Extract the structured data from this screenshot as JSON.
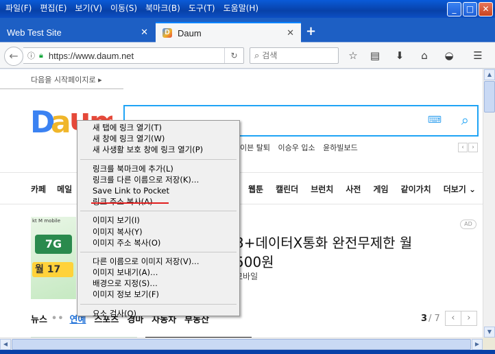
{
  "menubar": {
    "items": [
      "파일(F)",
      "편집(E)",
      "보기(V)",
      "이동(S)",
      "북마크(B)",
      "도구(T)",
      "도움말(H)"
    ]
  },
  "tabs": [
    {
      "title": "Web Test Site",
      "active": false
    },
    {
      "title": "Daum",
      "active": true
    }
  ],
  "navbar": {
    "url": "https://www.daum.net",
    "search_placeholder": "검색"
  },
  "page": {
    "start_page_link": "다음을 시작페이지로",
    "keywords": [
      "이븐 탈퇴",
      "이승우 입소",
      "윤하빌보드"
    ],
    "gnb_left": [
      "카페",
      "메일"
    ],
    "gnb_right": [
      "웹툰",
      "캘린더",
      "브런치",
      "사전",
      "게임",
      "같이가치",
      "더보기"
    ],
    "ad": {
      "brand": "kt M mobile",
      "img_big": "7G",
      "img_yellow": "월 17",
      "headline1": "3+데이터X통화 완전무제한 월",
      "headline2": "500원",
      "sub": "모바일",
      "badge": "AD"
    },
    "news": {
      "label": "뉴스",
      "tabs": [
        "연예",
        "스포츠",
        "경마",
        "자동차",
        "부동산"
      ],
      "active_tab": "연예",
      "page_current": "3",
      "page_total": "/ 7"
    }
  },
  "context_menu": {
    "group1": [
      "새 탭에 링크 열기(T)",
      "새 창에 링크 열기(W)",
      "새 사생활 보호 창에 링크 열기(P)"
    ],
    "group2": [
      "링크를 북마크에 추가(L)",
      "링크를 다른 이름으로 저장(K)…",
      "Save Link to Pocket",
      "링크 주소 복사(A)"
    ],
    "group3": [
      "이미지 보기(I)",
      "이미지 복사(Y)",
      "이미지 주소 복사(O)"
    ],
    "group4": [
      "다른 이름으로 이미지 저장(V)…",
      "이미지 보내기(A)…",
      "배경으로 지정(S)…",
      "이미지 정보 보기(F)"
    ],
    "group5": [
      "요소 검사(Q)"
    ],
    "highlighted_item": "링크 주소 복사(A)",
    "highlight_color": "#e11d1d"
  },
  "colors": {
    "titlebar": "#0841a8",
    "tab_strip": "#1d5fc4",
    "search_border": "#1ea3f5",
    "news_active": "#1c6fd8"
  }
}
